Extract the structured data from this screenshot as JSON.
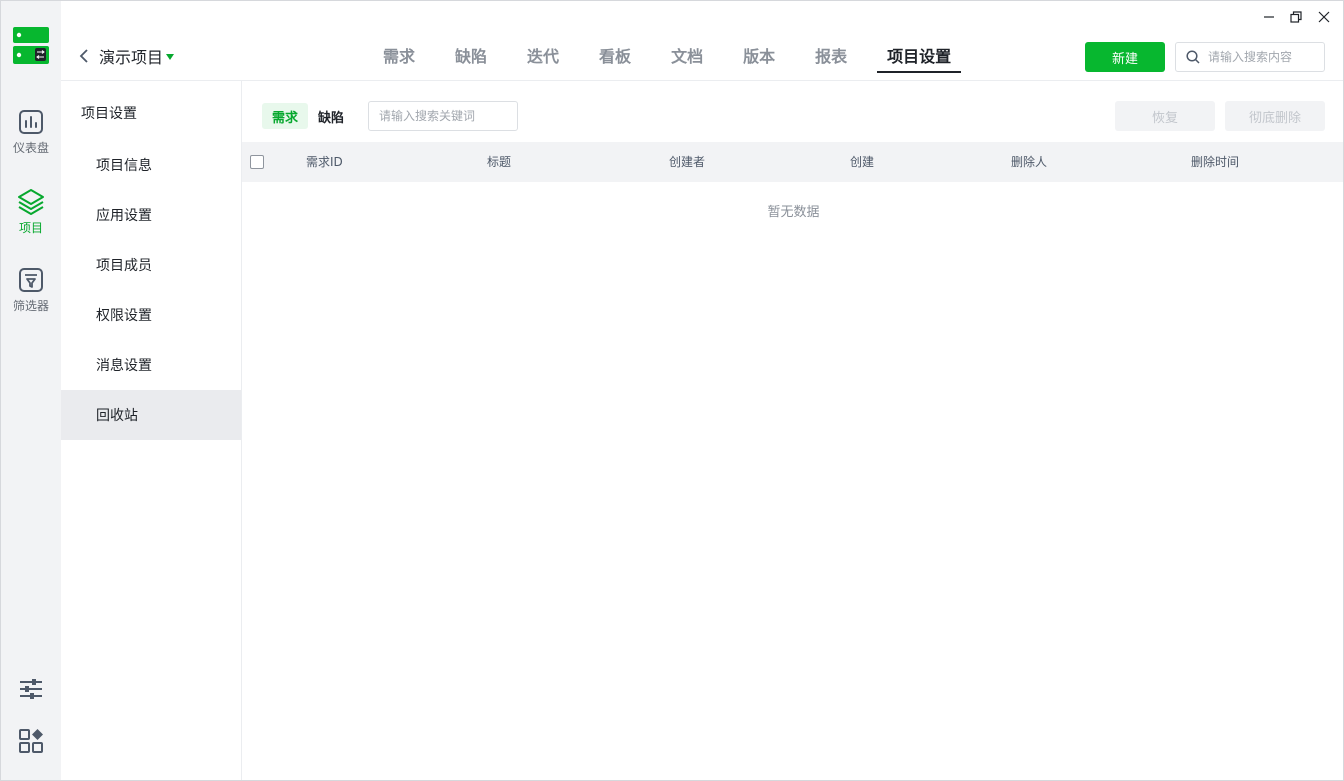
{
  "rail": {
    "items": [
      {
        "label": "仪表盘"
      },
      {
        "label": "项目"
      },
      {
        "label": "筛选器"
      }
    ]
  },
  "project": {
    "name": "演示项目"
  },
  "tabs": [
    {
      "label": "需求"
    },
    {
      "label": "缺陷"
    },
    {
      "label": "迭代"
    },
    {
      "label": "看板"
    },
    {
      "label": "文档"
    },
    {
      "label": "版本"
    },
    {
      "label": "报表"
    },
    {
      "label": "项目设置"
    }
  ],
  "header": {
    "new_label": "新建",
    "search_placeholder": "请输入搜索内容"
  },
  "side": {
    "title": "项目设置",
    "items": [
      {
        "label": "项目信息"
      },
      {
        "label": "应用设置"
      },
      {
        "label": "项目成员"
      },
      {
        "label": "权限设置"
      },
      {
        "label": "消息设置"
      },
      {
        "label": "回收站"
      }
    ]
  },
  "content": {
    "segments": [
      {
        "label": "需求"
      },
      {
        "label": "缺陷"
      }
    ],
    "search_placeholder": "请输入搜索关键词",
    "restore_label": "恢复",
    "purge_label": "彻底删除",
    "columns": [
      "需求ID",
      "标题",
      "创建者",
      "创建",
      "删除人",
      "删除时间"
    ],
    "empty_text": "暂无数据"
  },
  "colors": {
    "accent": "#07b72f",
    "accent_text": "#07a82e",
    "rail_bg": "#f2f3f5"
  }
}
